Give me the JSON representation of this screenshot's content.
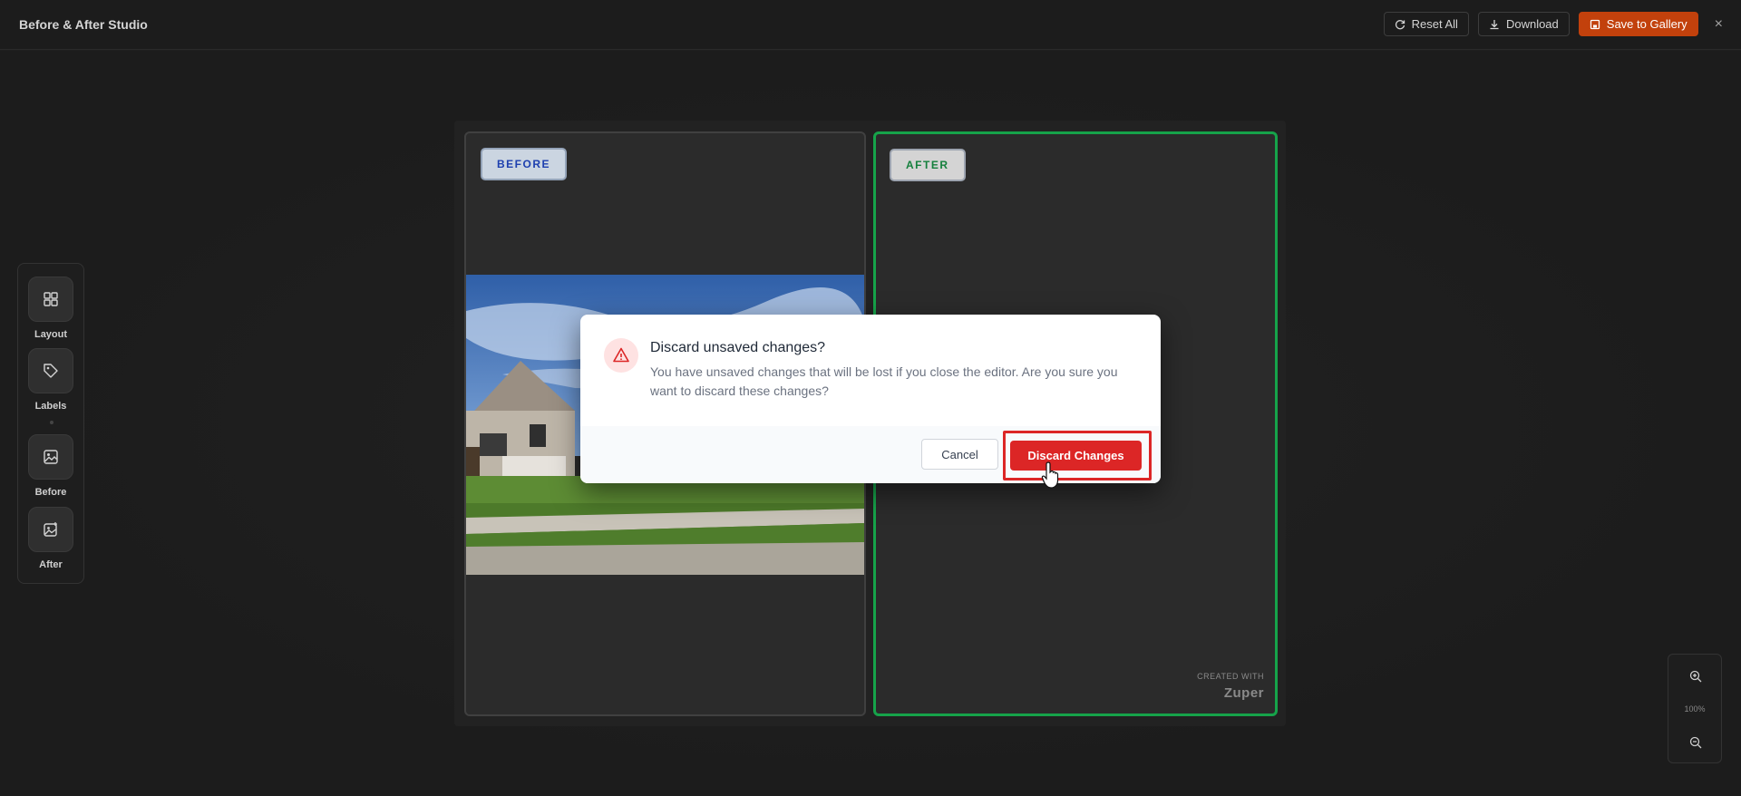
{
  "header": {
    "title": "Before & After Studio",
    "reset_label": "Reset All",
    "download_label": "Download",
    "save_label": "Save to Gallery",
    "close_glyph": "×"
  },
  "panels": {
    "before_tag": "BEFORE",
    "after_tag": "AFTER",
    "credit_line1": "CREATED WITH",
    "credit_line2": "Zuper"
  },
  "toolbar": {
    "items": [
      {
        "label": "Layout",
        "icon": "layout-grid-icon"
      },
      {
        "label": "Labels",
        "icon": "tag-icon"
      },
      {
        "label": "Before",
        "icon": "image-icon"
      },
      {
        "label": "After",
        "icon": "image-plus-icon"
      }
    ]
  },
  "zoom": {
    "level": "100%"
  },
  "dialog": {
    "title": "Discard unsaved changes?",
    "message": "You have unsaved changes that will be lost if you close the editor. Are you sure you want to discard these changes?",
    "cancel_label": "Cancel",
    "discard_label": "Discard Changes"
  },
  "colors": {
    "accent_orange": "#c2410c",
    "after_border_green": "#16a34a",
    "danger_red": "#dc2626"
  }
}
